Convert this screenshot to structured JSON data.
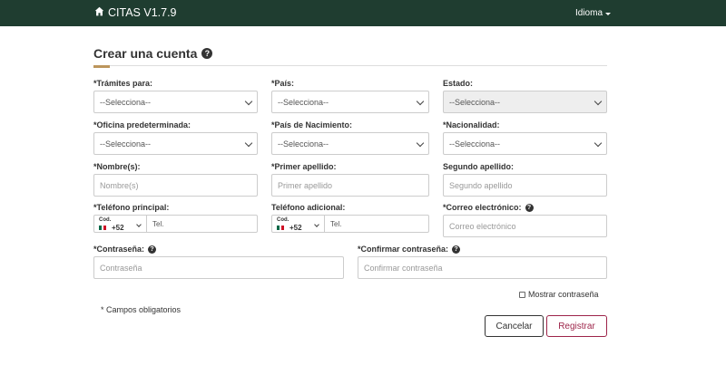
{
  "header": {
    "app_name": "CITAS V1.7.9",
    "language_label": "Idioma",
    "bg_color": "#1f3d30"
  },
  "form": {
    "title": "Crear una cuenta",
    "title_icon": "question-circle-icon",
    "fields": {
      "tramites": {
        "label": "*Trámites para:",
        "value": "--Selecciona--"
      },
      "pais": {
        "label": "*País:",
        "value": "--Selecciona--"
      },
      "estado": {
        "label": "Estado:",
        "value": "--Selecciona--"
      },
      "oficina": {
        "label": "*Oficina predeterminada:",
        "value": "--Selecciona--"
      },
      "pais_nacimiento": {
        "label": "*País de Nacimiento:",
        "value": "--Selecciona--"
      },
      "nacionalidad": {
        "label": "*Nacionalidad:",
        "value": "--Selecciona--"
      },
      "nombre": {
        "label": "*Nombre(s):",
        "placeholder": "Nombre(s)"
      },
      "primer_apellido": {
        "label": "*Primer apellido:",
        "placeholder": "Primer apellido"
      },
      "segundo_apellido": {
        "label": "Segundo apellido:",
        "placeholder": "Segundo apellido"
      },
      "telefono_principal": {
        "label": "*Teléfono principal:",
        "cod_label": "Cod.",
        "country_code": "+52",
        "placeholder": "Tel."
      },
      "telefono_adicional": {
        "label": "Teléfono adicional:",
        "cod_label": "Cod.",
        "country_code": "+52",
        "placeholder": "Tel."
      },
      "correo": {
        "label": "*Correo electrónico:",
        "placeholder": "Correo electrónico"
      },
      "contrasena": {
        "label": "*Contraseña:",
        "placeholder": "Contraseña"
      },
      "confirmar_contrasena": {
        "label": "*Confirmar contraseña:",
        "placeholder": "Confirmar contraseña"
      }
    },
    "show_password_label": "Mostrar contraseña",
    "required_note": "* Campos obligatorios",
    "cancel_label": "Cancelar",
    "register_label": "Registrar",
    "accent_color": "#9d2449"
  }
}
